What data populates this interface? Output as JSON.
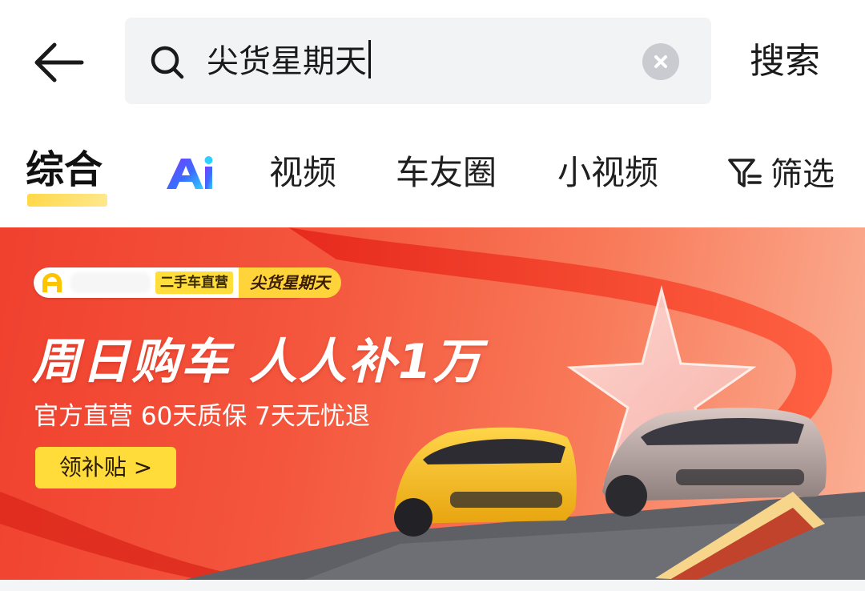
{
  "search": {
    "query": "尖货星期天",
    "submit_label": "搜索"
  },
  "tabs": [
    {
      "label": "综合",
      "active": true
    },
    {
      "label": "Ai",
      "active": false
    },
    {
      "label": "视频",
      "active": false
    },
    {
      "label": "车友圈",
      "active": false
    },
    {
      "label": "小视频",
      "active": false
    }
  ],
  "filter": {
    "label": "筛选"
  },
  "banner": {
    "brand_sub": "二手车直营",
    "brand_event": "尖货星期天",
    "title": "周日购车 人人补1万",
    "subtitle": "官方直营 60天质保 7天无忧退",
    "cta": "领补贴 >",
    "voucher_label": "尖货星期天",
    "voucher_amount": "10000"
  },
  "colors": {
    "accent_yellow": "#ffdc3a",
    "banner_red": "#f0402e",
    "search_bg": "#f2f3f5"
  },
  "icons": [
    "back-arrow-icon",
    "search-icon",
    "clear-icon",
    "ai-logo-icon",
    "filter-icon",
    "brand-logo-icon"
  ]
}
